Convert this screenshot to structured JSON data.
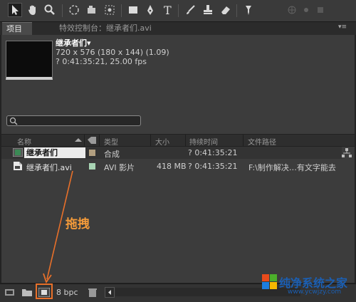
{
  "tabs": {
    "project": "项目",
    "effects": "特效控制台：继承者们.avi",
    "menu_glyph": "▾≡"
  },
  "footage_info": {
    "name": "继承者们▾",
    "resolution": "720 x 576  (180 x 144) (1.09)",
    "duration": "? 0:41:35:21, 25.00 fps"
  },
  "search": {
    "placeholder": ""
  },
  "columns": {
    "name": "名称",
    "type": "类型",
    "size": "大小",
    "duration": "持续时间",
    "path": "文件路径"
  },
  "rows": [
    {
      "name": "继承者们",
      "type": "合成",
      "size": "",
      "duration": "? 0:41:35:21",
      "path": "",
      "label_color": "#b29f80"
    },
    {
      "name": "继承者们.avi",
      "type": "AVI 影片",
      "size": "418 MB",
      "duration": "? 0:41:35:21",
      "path": "F:\\制作解决…有文字能去",
      "label_color": "#a8d4b4"
    }
  ],
  "annotation": {
    "text": "拖拽",
    "color": "#f39a3a"
  },
  "statusbar": {
    "bpc": "8 bpc"
  },
  "watermark": {
    "title": "纯净系统之家",
    "url": "www.ycwjzy.com"
  },
  "icons": [
    "selection-tool",
    "hand-tool",
    "zoom-tool",
    "rotate-tool",
    "camera-tool",
    "pan-behind-tool",
    "rectangle-tool",
    "pen-tool",
    "text-tool",
    "brush-tool",
    "clone-stamp-tool",
    "eraser-tool",
    "puppet-pin-tool",
    "interpret-footage-icon",
    "new-folder-icon",
    "new-composition-icon",
    "trash-icon"
  ]
}
